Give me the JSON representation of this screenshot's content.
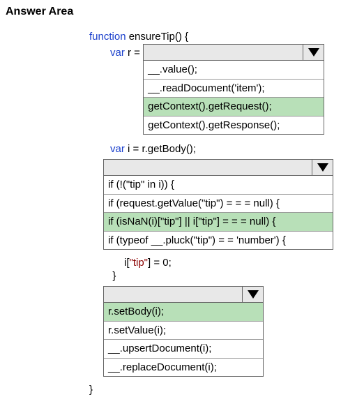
{
  "title": "Answer Area",
  "code": {
    "fn_decl_kw": "function",
    "fn_name": " ensureTip() {",
    "var_kw": "var",
    "r_equals": " r = ",
    "getBody": " i = r.getBody();",
    "tip_assign_pre": "            i[",
    "tip_key": "\"tip\"",
    "tip_assign_post": "] = 0;",
    "close_inner": "        }",
    "close_outer": "}"
  },
  "dropdown1": {
    "selected": "",
    "options": [
      {
        "text": "__.value();",
        "hl": false
      },
      {
        "text": "__.readDocument('item');",
        "hl": false
      },
      {
        "text": "getContext().getRequest();",
        "hl": true
      },
      {
        "text": "getContext().getResponse();",
        "hl": false
      }
    ]
  },
  "dropdown2": {
    "selected": "",
    "options": [
      {
        "text": "if (!(\"tip\" in i)) {",
        "hl": false
      },
      {
        "text": "if (request.getValue(\"tip\") = = = null) {",
        "hl": false
      },
      {
        "text": "if (isNaN(i)[\"tip\"] || i[\"tip\"] = = = null) {",
        "hl": true
      },
      {
        "text": "if (typeof __.pluck(\"tip\") = = 'number') {",
        "hl": false
      }
    ]
  },
  "dropdown3": {
    "selected": "",
    "options": [
      {
        "text": "r.setBody(i);",
        "hl": true
      },
      {
        "text": "r.setValue(i);",
        "hl": false
      },
      {
        "text": "__.upsertDocument(i);",
        "hl": false
      },
      {
        "text": "__.replaceDocument(i);",
        "hl": false
      }
    ]
  }
}
